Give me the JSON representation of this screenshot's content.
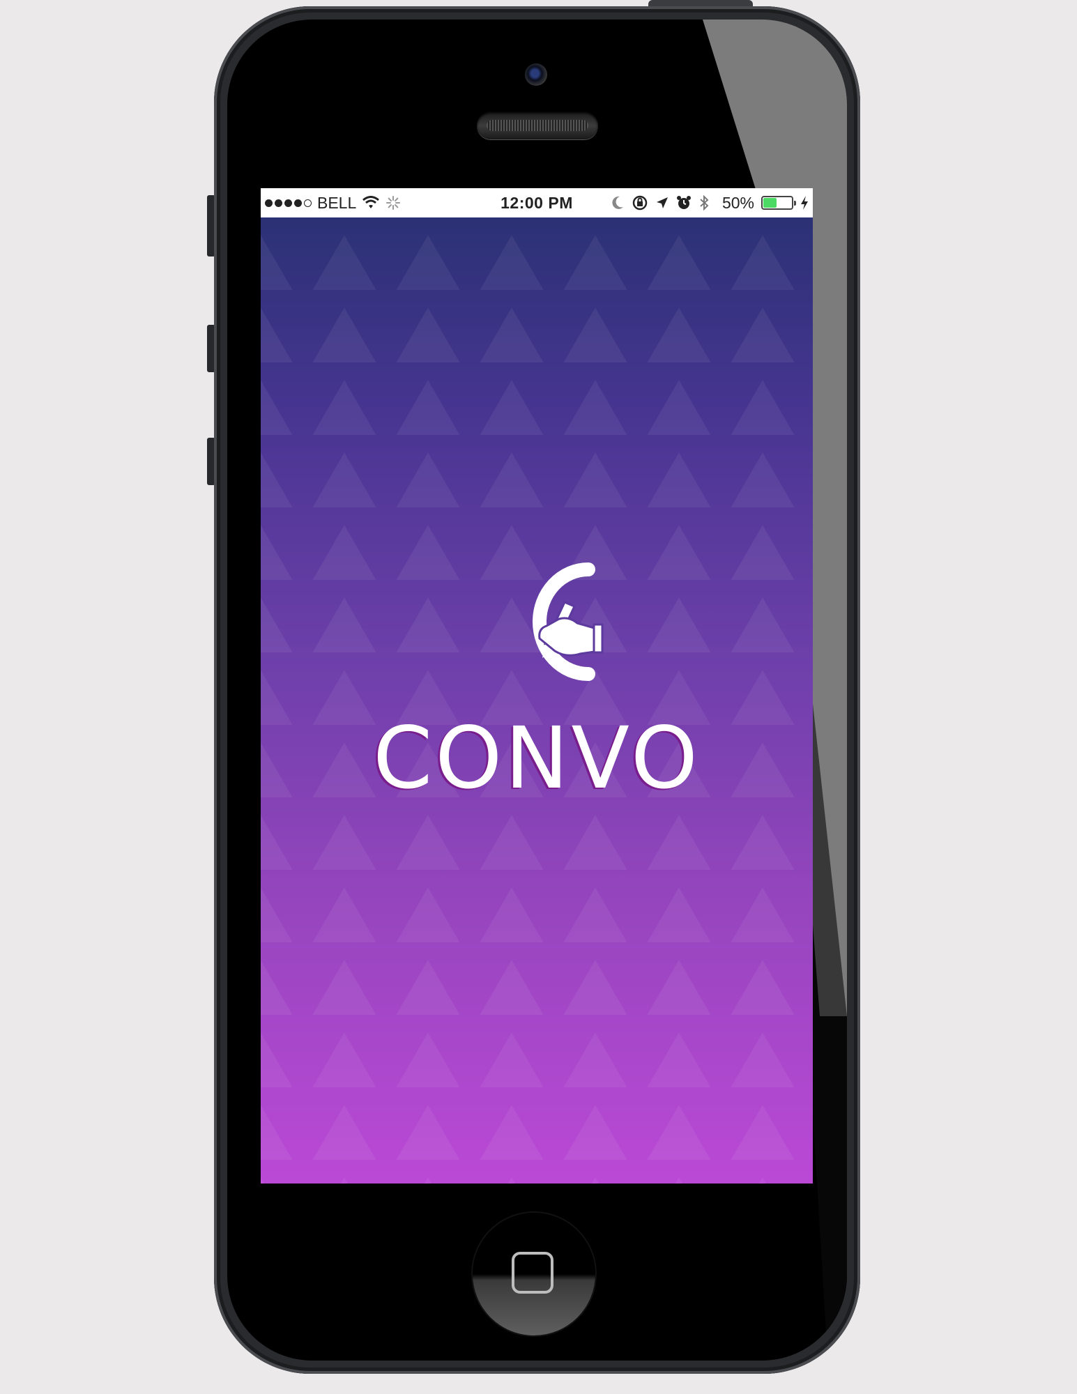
{
  "status_bar": {
    "carrier": "BELL",
    "time": "12:00 PM",
    "battery_percent_label": "50%",
    "battery_level": 0.5,
    "signal_bars_filled": 4,
    "signal_bars_total": 5
  },
  "splash": {
    "app_name": "CONVO",
    "logo_icon": "c-hand-pen-logo-icon"
  },
  "colors": {
    "gradient_top": "#2b3175",
    "gradient_bottom": "#bb49d6",
    "title_shadow": "#7a1d8c",
    "battery_fill": "#4cd964"
  }
}
